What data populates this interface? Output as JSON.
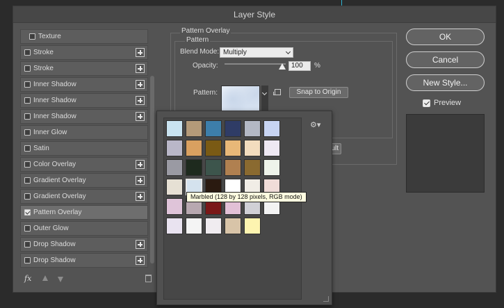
{
  "window": {
    "title": "Layer Style"
  },
  "styles": [
    {
      "label": "Texture",
      "checked": false,
      "plus": false,
      "sub": true
    },
    {
      "label": "Stroke",
      "checked": false,
      "plus": true
    },
    {
      "label": "Stroke",
      "checked": false,
      "plus": true
    },
    {
      "label": "Inner Shadow",
      "checked": false,
      "plus": true
    },
    {
      "label": "Inner Shadow",
      "checked": false,
      "plus": true
    },
    {
      "label": "Inner Shadow",
      "checked": false,
      "plus": true
    },
    {
      "label": "Inner Glow",
      "checked": false,
      "plus": false
    },
    {
      "label": "Satin",
      "checked": false,
      "plus": false
    },
    {
      "label": "Color Overlay",
      "checked": false,
      "plus": true
    },
    {
      "label": "Gradient Overlay",
      "checked": false,
      "plus": true
    },
    {
      "label": "Gradient Overlay",
      "checked": false,
      "plus": true
    },
    {
      "label": "Pattern Overlay",
      "checked": true,
      "plus": false,
      "selected": true
    },
    {
      "label": "Outer Glow",
      "checked": false,
      "plus": false
    },
    {
      "label": "Drop Shadow",
      "checked": false,
      "plus": true
    },
    {
      "label": "Drop Shadow",
      "checked": false,
      "plus": true
    }
  ],
  "footer": {
    "fx_label": "fx"
  },
  "panel": {
    "title": "Pattern Overlay",
    "group_title": "Pattern",
    "blend_mode_label": "Blend Mode:",
    "blend_mode_value": "Multiply",
    "opacity_label": "Opacity:",
    "opacity_value": "100",
    "opacity_unit": "%",
    "pattern_label": "Pattern:",
    "snap_button": "Snap to Origin",
    "hidden_button_fragment": "ult"
  },
  "buttons": {
    "ok": "OK",
    "cancel": "Cancel",
    "new_style": "New Style...",
    "preview": "Preview"
  },
  "picker": {
    "tiles": [
      [
        "#c9e3f0",
        "#b49a79",
        "#3d7eaa",
        "#2f3c66",
        "#b3b8c4",
        "#c7d4f2"
      ],
      [
        "#b9b7c8",
        "#d9a060",
        "#7a5a14",
        "#e8b878",
        "#f2dcbe",
        "#eee8f3"
      ],
      [
        "#9a9aa3",
        "#1e2a1e",
        "#3d554c",
        "#b08050",
        "#8a6a30",
        "#eef3ea"
      ],
      [
        "#e6e0d4",
        "#d4e2ee",
        "#2a1a10",
        "#ffffff",
        "#f1ede6",
        "#f0dcd8"
      ],
      [
        "#dfc4d9",
        "#b8a8b0",
        "#7a1818",
        "#e2c0d6",
        "#d0d0d6",
        "#f3f3f3"
      ],
      [
        "#e9e3f0",
        "#f4f4f4",
        "#f0ecf0",
        "#d8c4a8",
        "#fdf4b0",
        null
      ]
    ],
    "selected": [
      3,
      1
    ],
    "tooltip": "Marbled (128 by 128 pixels, RGB mode)"
  }
}
